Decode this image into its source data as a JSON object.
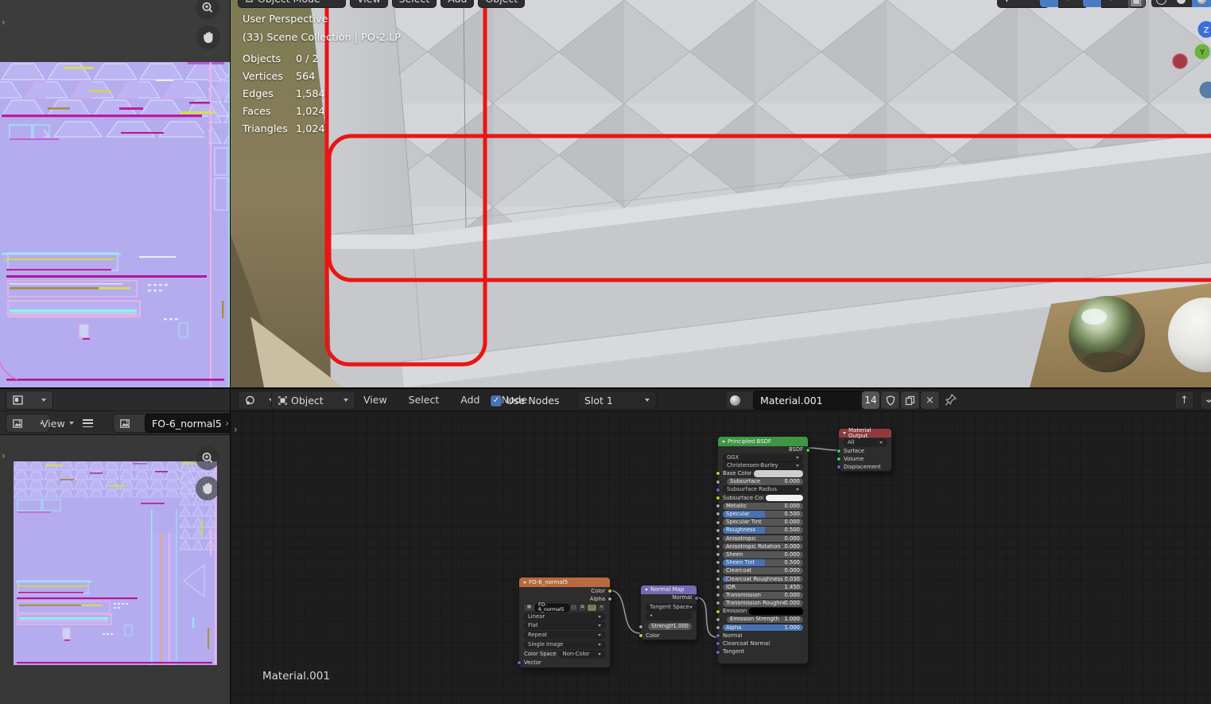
{
  "viewport": {
    "header": {
      "mode": "Object Mode",
      "menus": [
        "View",
        "Select",
        "Add",
        "Object"
      ]
    },
    "overlay": {
      "view_name": "User Perspective",
      "collection": "(33) Scene Collection | PO-2.LP",
      "stats": [
        {
          "label": "Objects",
          "value": "0 / 2"
        },
        {
          "label": "Vertices",
          "value": "564"
        },
        {
          "label": "Edges",
          "value": "1,584"
        },
        {
          "label": "Faces",
          "value": "1,024"
        },
        {
          "label": "Triangles",
          "value": "1,024"
        }
      ]
    },
    "gizmo_axes": {
      "z": "Z",
      "y": "Y"
    },
    "annotation_color": "#ea1515"
  },
  "image_editor": {
    "view_menu": "View",
    "image_name": "FO-6_normal5"
  },
  "node_editor": {
    "header": {
      "object_type": "Object",
      "menus": [
        "View",
        "Select",
        "Add",
        "Node"
      ],
      "use_nodes_label": "Use Nodes",
      "use_nodes_checked": true,
      "slot": "Slot 1",
      "material_name": "Material.001",
      "users_count": "14"
    },
    "canvas_label": "Material.001",
    "nodes": {
      "image_texture": {
        "title": "FO-6_normal5",
        "outputs": [
          "Color",
          "Alpha"
        ],
        "image_name": "FO-6_normal5",
        "dropdowns": [
          "Linear",
          "Flat",
          "Repeat",
          "Single Image"
        ],
        "colorspace_label": "Color Space",
        "colorspace_value": "Non-Color",
        "input": "Vector",
        "header_color": "#b96a3e"
      },
      "normal_map": {
        "title": "Normal Map",
        "output": "Normal",
        "space": "Tangent Space",
        "uv_field": "•",
        "strength_label": "Strength",
        "strength_value": "1.000",
        "input": "Color",
        "header_color": "#7968b5"
      },
      "principled": {
        "title": "Principled BSDF",
        "output": "BSDF",
        "distribution": "GGX",
        "subsurface_method": "Christensen-Burley",
        "rows": [
          {
            "label": "Base Color",
            "type": "color",
            "swatch": "#cdced1",
            "socket": "col"
          },
          {
            "label": "Subsurface",
            "type": "slider",
            "value": "0.000",
            "fill": 0,
            "socket": "flt",
            "indent": true
          },
          {
            "label": "Subsurface Radius",
            "type": "dropdown",
            "socket": "vec"
          },
          {
            "label": "Subsurface Col",
            "type": "color",
            "swatch": "#f1f1f1",
            "socket": "col"
          },
          {
            "label": "Metallic",
            "type": "slider",
            "value": "0.000",
            "fill": 0,
            "socket": "flt"
          },
          {
            "label": "Specular",
            "type": "slider",
            "value": "0.500",
            "fill": 0.52,
            "socket": "flt"
          },
          {
            "label": "Specular Tint",
            "type": "slider",
            "value": "0.000",
            "fill": 0,
            "socket": "flt"
          },
          {
            "label": "Roughness",
            "type": "slider",
            "value": "0.500",
            "fill": 0.52,
            "socket": "flt"
          },
          {
            "label": "Anisotropic",
            "type": "slider",
            "value": "0.000",
            "fill": 0,
            "socket": "flt"
          },
          {
            "label": "Anisotropic Rotation",
            "type": "slider",
            "value": "0.000",
            "fill": 0,
            "socket": "flt"
          },
          {
            "label": "Sheen",
            "type": "slider",
            "value": "0.000",
            "fill": 0,
            "socket": "flt"
          },
          {
            "label": "Sheen Tint",
            "type": "slider",
            "value": "0.500",
            "fill": 0.52,
            "socket": "flt"
          },
          {
            "label": "Clearcoat",
            "type": "slider",
            "value": "0.000",
            "fill": 0,
            "socket": "flt"
          },
          {
            "label": "Clearcoat Roughness",
            "type": "slider",
            "value": "0.030",
            "fill": 0.05,
            "socket": "flt"
          },
          {
            "label": "IOR",
            "type": "slider",
            "value": "1.450",
            "fill": 0,
            "socket": "flt"
          },
          {
            "label": "Transmission",
            "type": "slider",
            "value": "0.000",
            "fill": 0,
            "socket": "flt"
          },
          {
            "label": "Transmission Roughness",
            "type": "slider",
            "value": "0.000",
            "fill": 0,
            "socket": "flt"
          },
          {
            "label": "Emission",
            "type": "color",
            "swatch": "#000000",
            "socket": "col"
          },
          {
            "label": "Emission Strength",
            "type": "slider",
            "value": "1.000",
            "fill": 0,
            "socket": "flt",
            "indent": true
          },
          {
            "label": "Alpha",
            "type": "slider",
            "value": "1.000",
            "fill": 1,
            "socket": "flt"
          }
        ],
        "bottom_inputs": [
          "Normal",
          "Clearcoat Normal",
          "Tangent"
        ],
        "header_color": "#3f9643"
      },
      "material_output": {
        "title": "Material Output",
        "target": "All",
        "inputs": [
          "Surface",
          "Volume",
          "Displacement"
        ],
        "header_color": "#903a40"
      }
    }
  },
  "colors": {
    "annotation_red": "#ea1515",
    "slider_fill_blue": "#4772b3",
    "socket_color_yellow": "#c7c729",
    "socket_float_gray": "#a1a1a1",
    "socket_vector_blue": "#6767c7",
    "socket_shader_green": "#47c747"
  },
  "icons": {
    "zoom": "magnifier-plus",
    "pan": "hand",
    "panel_toggle": "chevron-right",
    "menu": "hamburger",
    "checkbox_check": "✓",
    "unlink": "×",
    "move_up": "↑",
    "pin": "pushpin",
    "fake_user": "shield",
    "duplicate": "copy-pages"
  }
}
